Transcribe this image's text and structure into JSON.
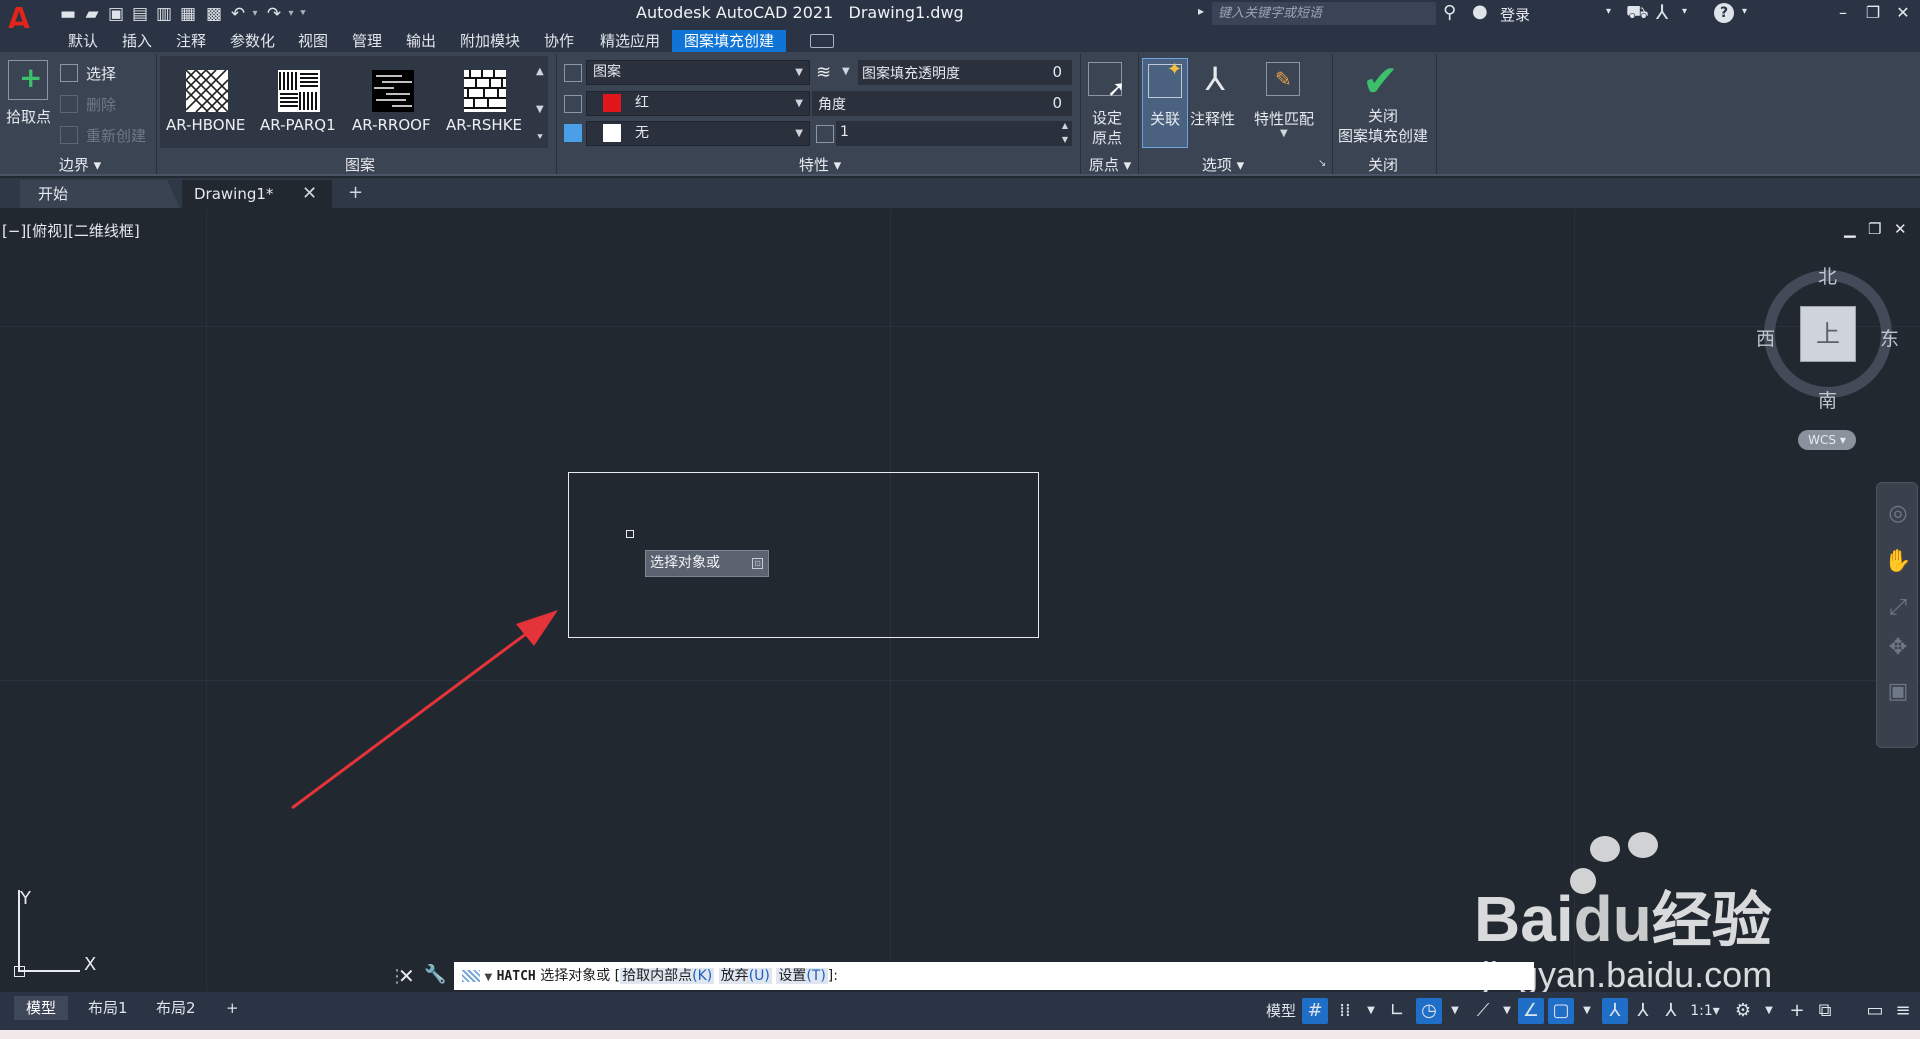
{
  "titlebar": {
    "app_title": "Autodesk AutoCAD 2021",
    "file_name": "Drawing1.dwg",
    "search_placeholder": "键入关键字或短语",
    "login": "登录"
  },
  "menu": {
    "tabs": [
      "默认",
      "插入",
      "注释",
      "参数化",
      "视图",
      "管理",
      "输出",
      "附加模块",
      "协作",
      "精选应用",
      "图案填充创建"
    ]
  },
  "ribbon": {
    "boundary": {
      "title": "边界",
      "pick_point": "拾取点",
      "select": "选择",
      "remove": "删除",
      "recreate": "重新创建"
    },
    "pattern": {
      "title": "图案",
      "items": [
        "AR-HBONE",
        "AR-PARQ1",
        "AR-RROOF",
        "AR-RSHKE"
      ]
    },
    "properties": {
      "title": "特性",
      "type": "图案",
      "color": "红",
      "background": "无",
      "transparency_label": "图案填充透明度",
      "transparency_value": "0",
      "angle_label": "角度",
      "angle_value": "0",
      "scale_value": "1"
    },
    "origin": {
      "title": "原点",
      "set_origin": "设定原点",
      "set_origin_line1": "设定",
      "set_origin_line2": "原点"
    },
    "options": {
      "title": "选项",
      "associative": "关联",
      "annotative": "注释性",
      "match_properties": "特性匹配"
    },
    "close": {
      "title": "关闭",
      "line1": "关闭",
      "line2": "图案填充创建"
    }
  },
  "doc_tabs": {
    "start": "开始",
    "drawing": "Drawing1*"
  },
  "viewport": {
    "label": "[−][俯视][二维线框]",
    "tooltip": "选择对象或"
  },
  "viewcube": {
    "north": "北",
    "south": "南",
    "east": "东",
    "west": "西",
    "face": "上",
    "wcs": "WCS"
  },
  "ucs": {
    "x": "X",
    "y": "Y"
  },
  "command": {
    "name": "HATCH",
    "prompt": "选择对象或",
    "bracket_open": "[",
    "opt1": "拾取内部点",
    "opt1_key": "(K)",
    "opt2": "放弃",
    "opt2_key": "(U)",
    "opt3": "设置",
    "opt3_key": "(T)",
    "bracket_close": "]:"
  },
  "status": {
    "layouts": [
      "模型",
      "布局1",
      "布局2"
    ],
    "scale": "1:1"
  },
  "watermark": {
    "brand_latin": "Bai",
    "brand_du": "du",
    "brand_cn": "经验",
    "url": "jingyan.baidu.com"
  },
  "colors": {
    "accent": "#0f74d6",
    "hatch_color": "#e0161b",
    "check_green": "#3cc06b",
    "background": "#212830"
  }
}
